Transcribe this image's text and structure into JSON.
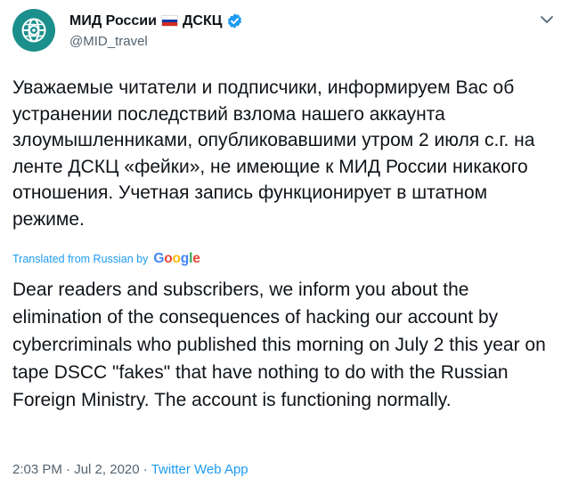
{
  "author": {
    "display_name": "МИД России",
    "display_suffix": "ДСКЦ",
    "handle": "@MID_travel",
    "verified": true
  },
  "tweet": {
    "text_ru": "Уважаемые читатели и подписчики, информируем Вас об устранении последствий взлома нашего аккаунта злоумышленниками, опубликовавшими утром 2 июля с.г. на ленте ДСКЦ «фейки», не имеющие к МИД России никакого отношения. Учетная запись функционирует в штатном режиме.",
    "translated_label": "Translated from Russian by",
    "translator": "Google",
    "text_en": "Dear readers and subscribers, we inform you about the elimination of the consequences of hacking our account by cybercriminals who published this morning on July 2 this year on tape DSCC \"fakes\" that have nothing to do with the Russian Foreign Ministry. The account is functioning normally."
  },
  "meta": {
    "time": "2:03 PM",
    "separator": "·",
    "date": "Jul 2, 2020",
    "app": "Twitter Web App"
  },
  "icons": {
    "avatar": "globe-icon",
    "verified": "verified-badge-icon",
    "flag": "russia-flag-icon",
    "menu": "chevron-down-icon"
  },
  "colors": {
    "text": "#0f1419",
    "secondary": "#536471",
    "link": "#1d9bf0",
    "avatar_bg": "#1b8f8c",
    "flag_white": "#ffffff",
    "flag_blue": "#0039a6",
    "flag_red": "#d52b1e"
  }
}
